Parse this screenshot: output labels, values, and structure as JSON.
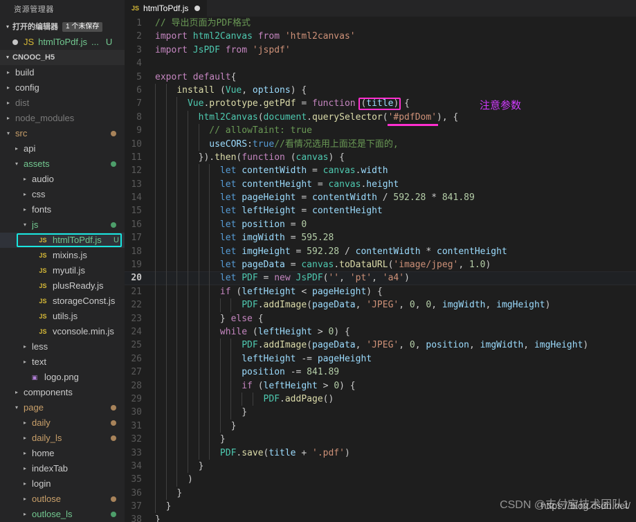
{
  "sidebar": {
    "title": "资源管理器",
    "open_editors": {
      "label": "打开的编辑器",
      "badge": "1 个未保存",
      "twisty": "▾",
      "items": [
        {
          "name": "htmlToPdf.js",
          "icon": "JS",
          "suffix": "...",
          "status": "U",
          "dirty": true
        }
      ]
    },
    "project": {
      "label": "CNOOC_H5",
      "twisty": "▾"
    },
    "tree": [
      {
        "label": "build",
        "indent": 1,
        "type": "folder",
        "twisty": "▸",
        "color": "#cccccc",
        "dot": ""
      },
      {
        "label": "config",
        "indent": 1,
        "type": "folder",
        "twisty": "▸",
        "color": "#cccccc",
        "dot": ""
      },
      {
        "label": "dist",
        "indent": 1,
        "type": "folder",
        "twisty": "▸",
        "color": "#7a7a7a",
        "dot": ""
      },
      {
        "label": "node_modules",
        "indent": 1,
        "type": "folder",
        "twisty": "▸",
        "color": "#7a7a7a",
        "dot": ""
      },
      {
        "label": "src",
        "indent": 1,
        "type": "folder",
        "twisty": "▾",
        "color": "#c9a06a",
        "dot": "#a8835a"
      },
      {
        "label": "api",
        "indent": 2,
        "type": "folder",
        "twisty": "▸",
        "color": "#cccccc",
        "dot": ""
      },
      {
        "label": "assets",
        "indent": 2,
        "type": "folder",
        "twisty": "▾",
        "color": "#73c991",
        "dot": "#4d9e6a"
      },
      {
        "label": "audio",
        "indent": 3,
        "type": "folder",
        "twisty": "▸",
        "color": "#cccccc",
        "dot": ""
      },
      {
        "label": "css",
        "indent": 3,
        "type": "folder",
        "twisty": "▸",
        "color": "#cccccc",
        "dot": ""
      },
      {
        "label": "fonts",
        "indent": 3,
        "type": "folder",
        "twisty": "▸",
        "color": "#cccccc",
        "dot": ""
      },
      {
        "label": "js",
        "indent": 3,
        "type": "folder",
        "twisty": "▾",
        "color": "#73c991",
        "dot": "#4d9e6a"
      },
      {
        "label": "htmlToPdf.js",
        "indent": 4,
        "type": "js",
        "twisty": "",
        "color": "#73c991",
        "dot": "",
        "status": "U",
        "selected": true
      },
      {
        "label": "mixins.js",
        "indent": 4,
        "type": "js",
        "twisty": "",
        "color": "#cccccc",
        "dot": ""
      },
      {
        "label": "myutil.js",
        "indent": 4,
        "type": "js",
        "twisty": "",
        "color": "#cccccc",
        "dot": ""
      },
      {
        "label": "plusReady.js",
        "indent": 4,
        "type": "js",
        "twisty": "",
        "color": "#cccccc",
        "dot": ""
      },
      {
        "label": "storageConst.js",
        "indent": 4,
        "type": "js",
        "twisty": "",
        "color": "#cccccc",
        "dot": ""
      },
      {
        "label": "utils.js",
        "indent": 4,
        "type": "js",
        "twisty": "",
        "color": "#cccccc",
        "dot": ""
      },
      {
        "label": "vconsole.min.js",
        "indent": 4,
        "type": "js",
        "twisty": "",
        "color": "#cccccc",
        "dot": ""
      },
      {
        "label": "less",
        "indent": 3,
        "type": "folder",
        "twisty": "▸",
        "color": "#cccccc",
        "dot": ""
      },
      {
        "label": "text",
        "indent": 3,
        "type": "folder",
        "twisty": "▸",
        "color": "#cccccc",
        "dot": ""
      },
      {
        "label": "logo.png",
        "indent": 3,
        "type": "png",
        "twisty": "",
        "color": "#cccccc",
        "dot": ""
      },
      {
        "label": "components",
        "indent": 2,
        "type": "folder",
        "twisty": "▸",
        "color": "#cccccc",
        "dot": ""
      },
      {
        "label": "page",
        "indent": 2,
        "type": "folder",
        "twisty": "▾",
        "color": "#c9a06a",
        "dot": "#a8835a"
      },
      {
        "label": "daily",
        "indent": 3,
        "type": "folder",
        "twisty": "▸",
        "color": "#c9a06a",
        "dot": "#a8835a"
      },
      {
        "label": "daily_ls",
        "indent": 3,
        "type": "folder",
        "twisty": "▸",
        "color": "#c9a06a",
        "dot": "#a8835a"
      },
      {
        "label": "home",
        "indent": 3,
        "type": "folder",
        "twisty": "▸",
        "color": "#cccccc",
        "dot": ""
      },
      {
        "label": "indexTab",
        "indent": 3,
        "type": "folder",
        "twisty": "▸",
        "color": "#cccccc",
        "dot": ""
      },
      {
        "label": "login",
        "indent": 3,
        "type": "folder",
        "twisty": "▸",
        "color": "#cccccc",
        "dot": ""
      },
      {
        "label": "outlose",
        "indent": 3,
        "type": "folder",
        "twisty": "▸",
        "color": "#c9a06a",
        "dot": "#a8835a"
      },
      {
        "label": "outlose_ls",
        "indent": 3,
        "type": "folder",
        "twisty": "▸",
        "color": "#73c991",
        "dot": "#4d9e6a"
      }
    ]
  },
  "tab": {
    "label": "htmlToPdf.js",
    "icon": "JS",
    "dirty": true
  },
  "annotations": {
    "note_text": "注意参数",
    "note_color": "#d13bff",
    "box_color": "#ff2fd0",
    "underline_color": "#ff2fd0",
    "selection_color": "#19e6e0"
  },
  "watermark": {
    "url": "https://blog.csdn.net/",
    "overlay": "CSDN @支付宝技术团队1"
  },
  "code": {
    "active_line": 20,
    "total_lines": 38,
    "lines": [
      {
        "n": 1,
        "text": "// 导出页面为PDF格式"
      },
      {
        "n": 2,
        "text": "import html2Canvas from 'html2canvas'"
      },
      {
        "n": 3,
        "text": "import JsPDF from 'jspdf'"
      },
      {
        "n": 4,
        "text": ""
      },
      {
        "n": 5,
        "text": "export default{"
      },
      {
        "n": 6,
        "text": "    install (Vue, options) {"
      },
      {
        "n": 7,
        "text": "      Vue.prototype.getPdf = function (title) {"
      },
      {
        "n": 8,
        "text": "        html2Canvas(document.querySelector('#pdfDom'), {"
      },
      {
        "n": 9,
        "text": "          // allowTaint: true"
      },
      {
        "n": 10,
        "text": "          useCORS:true//看情况选用上面还是下面的,"
      },
      {
        "n": 11,
        "text": "        }).then(function (canvas) {"
      },
      {
        "n": 12,
        "text": "            let contentWidth = canvas.width"
      },
      {
        "n": 13,
        "text": "            let contentHeight = canvas.height"
      },
      {
        "n": 14,
        "text": "            let pageHeight = contentWidth / 592.28 * 841.89"
      },
      {
        "n": 15,
        "text": "            let leftHeight = contentHeight"
      },
      {
        "n": 16,
        "text": "            let position = 0"
      },
      {
        "n": 17,
        "text": "            let imgWidth = 595.28"
      },
      {
        "n": 18,
        "text": "            let imgHeight = 592.28 / contentWidth * contentHeight"
      },
      {
        "n": 19,
        "text": "            let pageData = canvas.toDataURL('image/jpeg', 1.0)"
      },
      {
        "n": 20,
        "text": "            let PDF = new JsPDF('', 'pt', 'a4')"
      },
      {
        "n": 21,
        "text": "            if (leftHeight < pageHeight) {"
      },
      {
        "n": 22,
        "text": "                PDF.addImage(pageData, 'JPEG', 0, 0, imgWidth, imgHeight)"
      },
      {
        "n": 23,
        "text": "            } else {"
      },
      {
        "n": 24,
        "text": "            while (leftHeight > 0) {"
      },
      {
        "n": 25,
        "text": "                PDF.addImage(pageData, 'JPEG', 0, position, imgWidth, imgHeight)"
      },
      {
        "n": 26,
        "text": "                leftHeight -= pageHeight"
      },
      {
        "n": 27,
        "text": "                position -= 841.89"
      },
      {
        "n": 28,
        "text": "                if (leftHeight > 0) {"
      },
      {
        "n": 29,
        "text": "                    PDF.addPage()"
      },
      {
        "n": 30,
        "text": "                }"
      },
      {
        "n": 31,
        "text": "              }"
      },
      {
        "n": 32,
        "text": "            }"
      },
      {
        "n": 33,
        "text": "            PDF.save(title + '.pdf')"
      },
      {
        "n": 34,
        "text": "        }"
      },
      {
        "n": 35,
        "text": "      )"
      },
      {
        "n": 36,
        "text": "    }"
      },
      {
        "n": 37,
        "text": "  }"
      },
      {
        "n": 38,
        "text": "}"
      }
    ]
  }
}
